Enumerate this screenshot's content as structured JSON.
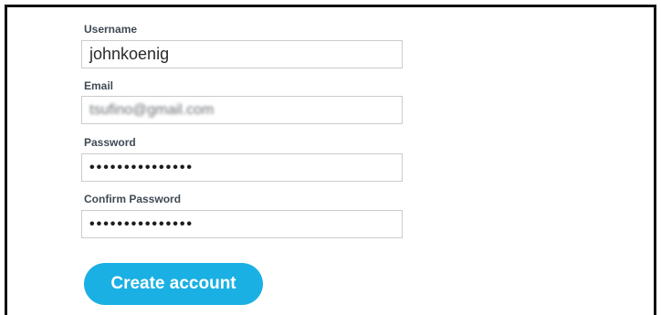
{
  "form": {
    "username": {
      "label": "Username",
      "value": "johnkoenig"
    },
    "email": {
      "label": "Email",
      "value": "tsufino@gmail.com"
    },
    "password": {
      "label": "Password",
      "value": "•••••••••••••••"
    },
    "confirm_password": {
      "label": "Confirm Password",
      "value": "•••••••••••••••"
    },
    "submit_label": "Create account"
  }
}
